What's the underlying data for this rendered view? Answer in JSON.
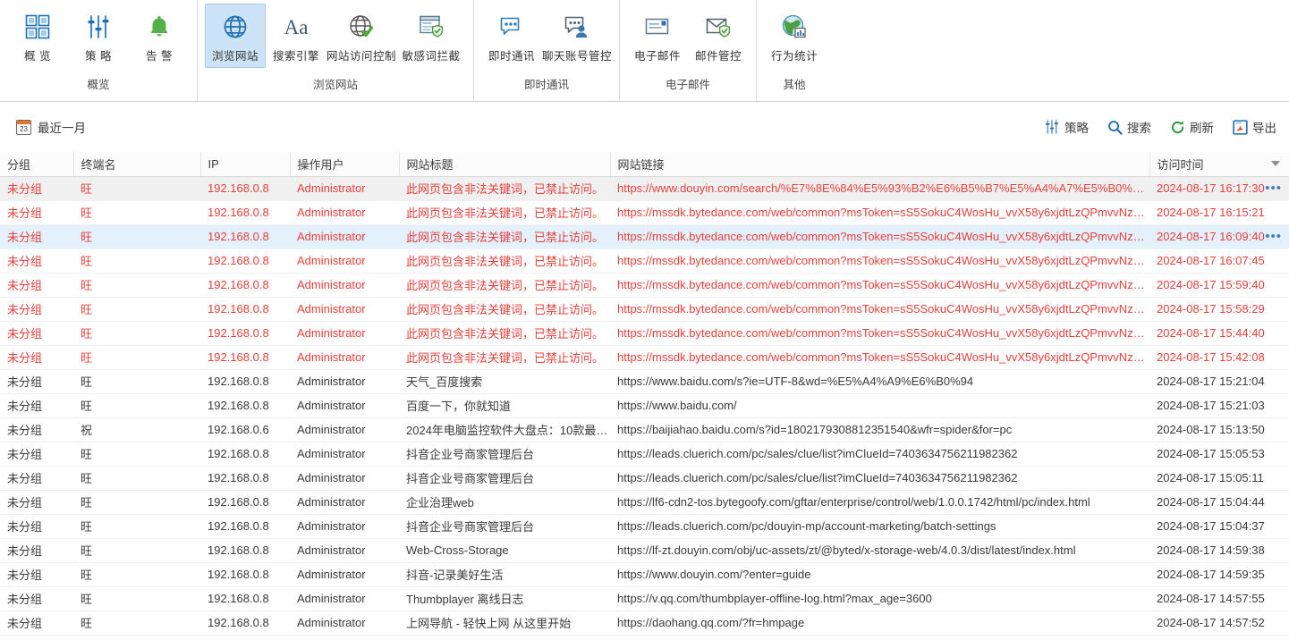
{
  "ribbon": {
    "groups": [
      {
        "title": "概览",
        "items": [
          {
            "label": "概  览",
            "icon": "grid-squares-icon",
            "selected": false
          },
          {
            "label": "策  略",
            "icon": "sliders-icon",
            "selected": false
          },
          {
            "label": "告  警",
            "icon": "bell-icon",
            "selected": false
          }
        ]
      },
      {
        "title": "浏览网站",
        "items": [
          {
            "label": "浏览网站",
            "icon": "globe-icon",
            "selected": true
          },
          {
            "label": "搜索引擎",
            "icon": "text-aa-icon",
            "selected": false
          },
          {
            "label": "网站访问控制",
            "icon": "globe-check-icon",
            "selected": false
          },
          {
            "label": "敏感词拦截",
            "icon": "page-shield-icon",
            "selected": false
          }
        ]
      },
      {
        "title": "即时通讯",
        "items": [
          {
            "label": "即时通讯",
            "icon": "chat-bubble-icon",
            "selected": false
          },
          {
            "label": "聊天账号管控",
            "icon": "chat-user-icon",
            "selected": false
          }
        ]
      },
      {
        "title": "电子邮件",
        "items": [
          {
            "label": "电子邮件",
            "icon": "mail-card-icon",
            "selected": false
          },
          {
            "label": "邮件管控",
            "icon": "mail-shield-icon",
            "selected": false
          }
        ]
      },
      {
        "title": "其他",
        "items": [
          {
            "label": "行为统计",
            "icon": "globe-stats-icon",
            "selected": false
          }
        ]
      }
    ]
  },
  "toolbar": {
    "date_filter_label": "最近一月",
    "calendar_day": "23",
    "actions": [
      {
        "label": "策略",
        "icon": "sliders-icon"
      },
      {
        "label": "搜索",
        "icon": "search-icon"
      },
      {
        "label": "刷新",
        "icon": "refresh-icon"
      },
      {
        "label": "导出",
        "icon": "export-icon"
      }
    ]
  },
  "table": {
    "columns": [
      {
        "label": "分组",
        "key": "group"
      },
      {
        "label": "终端名",
        "key": "terminal"
      },
      {
        "label": "IP",
        "key": "ip"
      },
      {
        "label": "操作用户",
        "key": "user"
      },
      {
        "label": "网站标题",
        "key": "title"
      },
      {
        "label": "网站链接",
        "key": "url"
      },
      {
        "label": "访问时间",
        "key": "time",
        "sortable": true
      }
    ],
    "rows": [
      {
        "group": "未分组",
        "terminal": "旺",
        "ip": "192.168.0.8",
        "user": "Administrator",
        "title": "此网页包含非法关键词，已禁止访问。",
        "url": "https://www.douyin.com/search/%E7%8E%84%E5%93%B2%E6%B5%B7%E5%A4%A7%E5%B0%86%E…",
        "time": "2024-08-17 16:17:30",
        "alert": true,
        "state": "hovered",
        "menu": true
      },
      {
        "group": "未分组",
        "terminal": "旺",
        "ip": "192.168.0.8",
        "user": "Administrator",
        "title": "此网页包含非法关键词，已禁止访问。",
        "url": "https://mssdk.bytedance.com/web/common?msToken=sS5SokuC4WosHu_vvX58y6xjdtLzQPmvvNzO…",
        "time": "2024-08-17 16:15:21",
        "alert": true,
        "state": "",
        "menu": false
      },
      {
        "group": "未分组",
        "terminal": "旺",
        "ip": "192.168.0.8",
        "user": "Administrator",
        "title": "此网页包含非法关键词，已禁止访问。",
        "url": "https://mssdk.bytedance.com/web/common?msToken=sS5SokuC4WosHu_vvX58y6xjdtLzQPmvvNzO…",
        "time": "2024-08-17 16:09:40",
        "alert": true,
        "state": "selected",
        "menu": true
      },
      {
        "group": "未分组",
        "terminal": "旺",
        "ip": "192.168.0.8",
        "user": "Administrator",
        "title": "此网页包含非法关键词，已禁止访问。",
        "url": "https://mssdk.bytedance.com/web/common?msToken=sS5SokuC4WosHu_vvX58y6xjdtLzQPmvvNzO…",
        "time": "2024-08-17 16:07:45",
        "alert": true,
        "state": "",
        "menu": false
      },
      {
        "group": "未分组",
        "terminal": "旺",
        "ip": "192.168.0.8",
        "user": "Administrator",
        "title": "此网页包含非法关键词，已禁止访问。",
        "url": "https://mssdk.bytedance.com/web/common?msToken=sS5SokuC4WosHu_vvX58y6xjdtLzQPmvvNzO…",
        "time": "2024-08-17 15:59:40",
        "alert": true,
        "state": "",
        "menu": false
      },
      {
        "group": "未分组",
        "terminal": "旺",
        "ip": "192.168.0.8",
        "user": "Administrator",
        "title": "此网页包含非法关键词，已禁止访问。",
        "url": "https://mssdk.bytedance.com/web/common?msToken=sS5SokuC4WosHu_vvX58y6xjdtLzQPmvvNzO…",
        "time": "2024-08-17 15:58:29",
        "alert": true,
        "state": "",
        "menu": false
      },
      {
        "group": "未分组",
        "terminal": "旺",
        "ip": "192.168.0.8",
        "user": "Administrator",
        "title": "此网页包含非法关键词，已禁止访问。",
        "url": "https://mssdk.bytedance.com/web/common?msToken=sS5SokuC4WosHu_vvX58y6xjdtLzQPmvvNzO…",
        "time": "2024-08-17 15:44:40",
        "alert": true,
        "state": "",
        "menu": false
      },
      {
        "group": "未分组",
        "terminal": "旺",
        "ip": "192.168.0.8",
        "user": "Administrator",
        "title": "此网页包含非法关键词，已禁止访问。",
        "url": "https://mssdk.bytedance.com/web/common?msToken=sS5SokuC4WosHu_vvX58y6xjdtLzQPmvvNzO…",
        "time": "2024-08-17 15:42:08",
        "alert": true,
        "state": "",
        "menu": false
      },
      {
        "group": "未分组",
        "terminal": "旺",
        "ip": "192.168.0.8",
        "user": "Administrator",
        "title": "天气_百度搜索",
        "url": "https://www.baidu.com/s?ie=UTF-8&wd=%E5%A4%A9%E6%B0%94",
        "time": "2024-08-17 15:21:04",
        "alert": false,
        "state": "",
        "menu": false
      },
      {
        "group": "未分组",
        "terminal": "旺",
        "ip": "192.168.0.8",
        "user": "Administrator",
        "title": "百度一下，你就知道",
        "url": "https://www.baidu.com/",
        "time": "2024-08-17 15:21:03",
        "alert": false,
        "state": "",
        "menu": false
      },
      {
        "group": "未分组",
        "terminal": "祝",
        "ip": "192.168.0.6",
        "user": "Administrator",
        "title": "2024年电脑监控软件大盘点：10款最值…",
        "url": "https://baijiahao.baidu.com/s?id=1802179308812351540&wfr=spider&for=pc",
        "time": "2024-08-17 15:13:50",
        "alert": false,
        "state": "",
        "menu": false
      },
      {
        "group": "未分组",
        "terminal": "旺",
        "ip": "192.168.0.8",
        "user": "Administrator",
        "title": "抖音企业号商家管理后台",
        "url": "https://leads.cluerich.com/pc/sales/clue/list?imClueId=7403634756211982362",
        "time": "2024-08-17 15:05:53",
        "alert": false,
        "state": "",
        "menu": false
      },
      {
        "group": "未分组",
        "terminal": "旺",
        "ip": "192.168.0.8",
        "user": "Administrator",
        "title": "抖音企业号商家管理后台",
        "url": "https://leads.cluerich.com/pc/sales/clue/list?imClueId=7403634756211982362",
        "time": "2024-08-17 15:05:11",
        "alert": false,
        "state": "",
        "menu": false
      },
      {
        "group": "未分组",
        "terminal": "旺",
        "ip": "192.168.0.8",
        "user": "Administrator",
        "title": "企业治理web",
        "url": "https://lf6-cdn2-tos.bytegoofy.com/gftar/enterprise/control/web/1.0.0.1742/html/pc/index.html",
        "time": "2024-08-17 15:04:44",
        "alert": false,
        "state": "",
        "menu": false
      },
      {
        "group": "未分组",
        "terminal": "旺",
        "ip": "192.168.0.8",
        "user": "Administrator",
        "title": "抖音企业号商家管理后台",
        "url": "https://leads.cluerich.com/pc/douyin-mp/account-marketing/batch-settings",
        "time": "2024-08-17 15:04:37",
        "alert": false,
        "state": "",
        "menu": false
      },
      {
        "group": "未分组",
        "terminal": "旺",
        "ip": "192.168.0.8",
        "user": "Administrator",
        "title": "Web-Cross-Storage",
        "url": "https://lf-zt.douyin.com/obj/uc-assets/zt/@byted/x-storage-web/4.0.3/dist/latest/index.html",
        "time": "2024-08-17 14:59:38",
        "alert": false,
        "state": "",
        "menu": false
      },
      {
        "group": "未分组",
        "terminal": "旺",
        "ip": "192.168.0.8",
        "user": "Administrator",
        "title": "抖音-记录美好生活",
        "url": "https://www.douyin.com/?enter=guide",
        "time": "2024-08-17 14:59:35",
        "alert": false,
        "state": "",
        "menu": false
      },
      {
        "group": "未分组",
        "terminal": "旺",
        "ip": "192.168.0.8",
        "user": "Administrator",
        "title": "Thumbplayer 离线日志",
        "url": "https://v.qq.com/thumbplayer-offline-log.html?max_age=3600",
        "time": "2024-08-17 14:57:55",
        "alert": false,
        "state": "",
        "menu": false
      },
      {
        "group": "未分组",
        "terminal": "旺",
        "ip": "192.168.0.8",
        "user": "Administrator",
        "title": "上网导航 - 轻快上网 从这里开始",
        "url": "https://daohang.qq.com/?fr=hmpage",
        "time": "2024-08-17 14:57:52",
        "alert": false,
        "state": "",
        "menu": false
      }
    ]
  },
  "colors": {
    "alert_red": "#e8413c",
    "accent_blue": "#2e7ab8",
    "selected_row": "#e4f0fb",
    "hover_row": "#f0f0f0"
  }
}
